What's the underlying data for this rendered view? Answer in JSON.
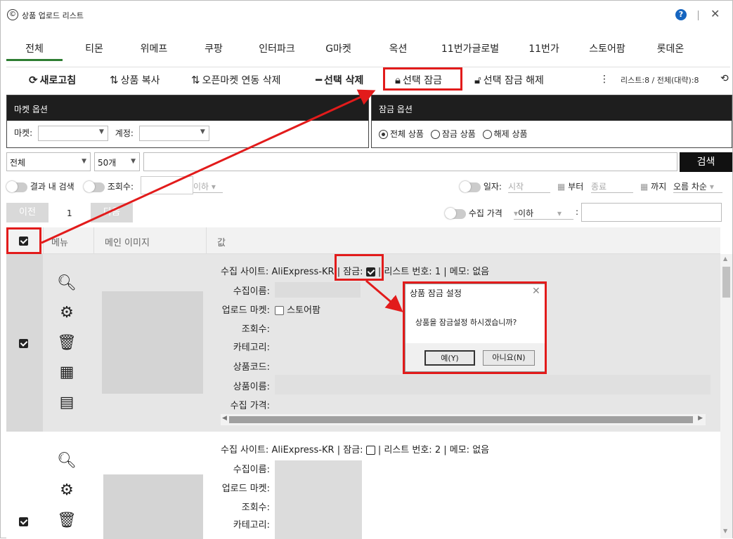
{
  "window": {
    "title": "상품 업로드 리스트",
    "help": "?",
    "close": "✕"
  },
  "tabs": [
    "전체",
    "티몬",
    "위메프",
    "쿠팡",
    "인터파크",
    "G마켓",
    "옥션",
    "11번가글로벌",
    "11번가",
    "스토어팜",
    "롯데온"
  ],
  "toolbar": {
    "refresh": "새로고침",
    "copy": "상품 복사",
    "open_market_delete": "오픈마켓 연동 삭제",
    "delete_selected": "선택 삭제",
    "lock_selected": "선택 잠금",
    "unlock_selected": "선택 잠금 해제",
    "list_info": "리스트:8  /  전체(대략):8"
  },
  "market_options": {
    "header": "마켓 옵션",
    "market_label": "마켓:",
    "account_label": "계정:"
  },
  "lock_options": {
    "header": "잠금 옵션",
    "all": "전체 상품",
    "locked": "잠금 상품",
    "unlocked": "해제 상품",
    "selected": "all"
  },
  "search": {
    "scope": "전체",
    "count": "50개",
    "button": "검색"
  },
  "filters": {
    "in_result": "결과 내 검색",
    "views": "조회수:",
    "below": "이하",
    "date": "일자:",
    "start": "시작",
    "from": "부터",
    "end": "종료",
    "until": "까지",
    "order": "오름 차순",
    "price": "수집 가격",
    "price_below": "이하",
    "colon": ":"
  },
  "pager": {
    "prev": "이전",
    "page": "1",
    "next": "다음"
  },
  "table": {
    "col_menu": "메뉴",
    "col_image": "메인 이미지",
    "col_value": "값"
  },
  "rows": [
    {
      "site_label": "수집 사이트:",
      "site": "AliExpress-KR",
      "lock_label": "잠금:",
      "locked": true,
      "list_no_label": "리스트 번호:",
      "list_no": "1",
      "memo_label": "메모:",
      "memo": "없음",
      "name_label": "수집이름:",
      "upload_label": "업로드 마켓:",
      "upload_market": "스토어팜",
      "views_label": "조회수:",
      "category_label": "카테고리:",
      "code_label": "상품코드:",
      "product_name_label": "상품이름:",
      "price_label": "수집 가격:"
    },
    {
      "site_label": "수집 사이트:",
      "site": "AliExpress-KR",
      "lock_label": "잠금:",
      "locked": false,
      "list_no_label": "리스트 번호:",
      "list_no": "2",
      "memo_label": "메모:",
      "memo": "없음",
      "name_label": "수집이름:",
      "upload_label": "업로드 마켓:",
      "views_label": "조회수:",
      "category_label": "카테고리:"
    }
  ],
  "dialog": {
    "title": "상품 잠금 설정",
    "message": "상품을 잠금설정 하시겠습니까?",
    "yes": "예(Y)",
    "no": "아니요(N)"
  },
  "colors": {
    "accent_tab": "#2e7d32",
    "annotation_red": "#e21b1b",
    "header_dark": "#1e1e1e"
  }
}
